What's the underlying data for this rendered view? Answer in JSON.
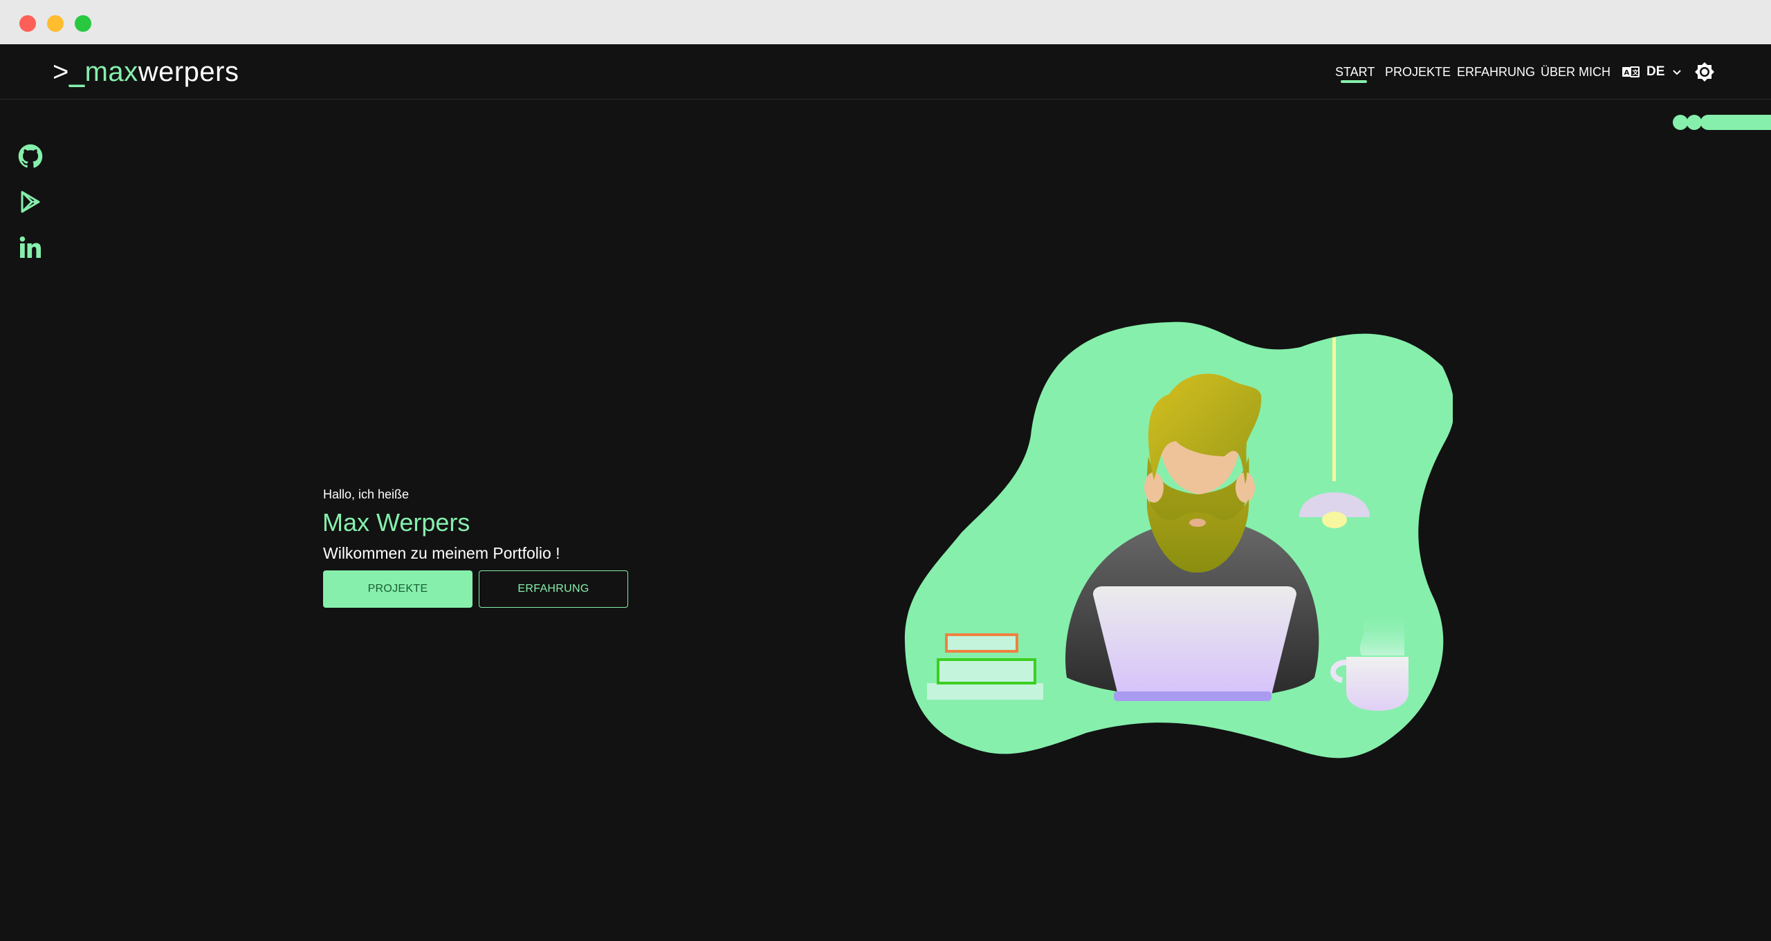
{
  "window": {
    "buttons": [
      "close",
      "minimize",
      "maximize"
    ]
  },
  "header": {
    "logo": {
      "prompt": ">",
      "cursor": "_",
      "first": "max",
      "second": "werpers"
    },
    "nav": [
      {
        "label": "START",
        "active": true
      },
      {
        "label": "PROJEKTE",
        "active": false
      },
      {
        "label": "ERFAHRUNG",
        "active": false
      },
      {
        "label": "ÜBER MICH",
        "active": false
      }
    ],
    "language": {
      "icon": "translate-icon",
      "label": "DE",
      "chevron": "chevron-down-icon"
    },
    "theme_toggle": {
      "icon": "brightness-icon"
    }
  },
  "social": [
    {
      "icon": "github-icon"
    },
    {
      "icon": "google-play-icon"
    },
    {
      "icon": "linkedin-icon"
    }
  ],
  "hero": {
    "greeting": "Hallo, ich heiße",
    "name": "Max Werpers",
    "welcome": "Wilkommen zu meinem Portfolio !",
    "primary_button": "PROJEKTE",
    "secondary_button": "ERFAHRUNG"
  },
  "colors": {
    "background": "#121212",
    "accent": "#86efac",
    "text": "#ffffff",
    "titlebar": "#e8e8e8"
  }
}
